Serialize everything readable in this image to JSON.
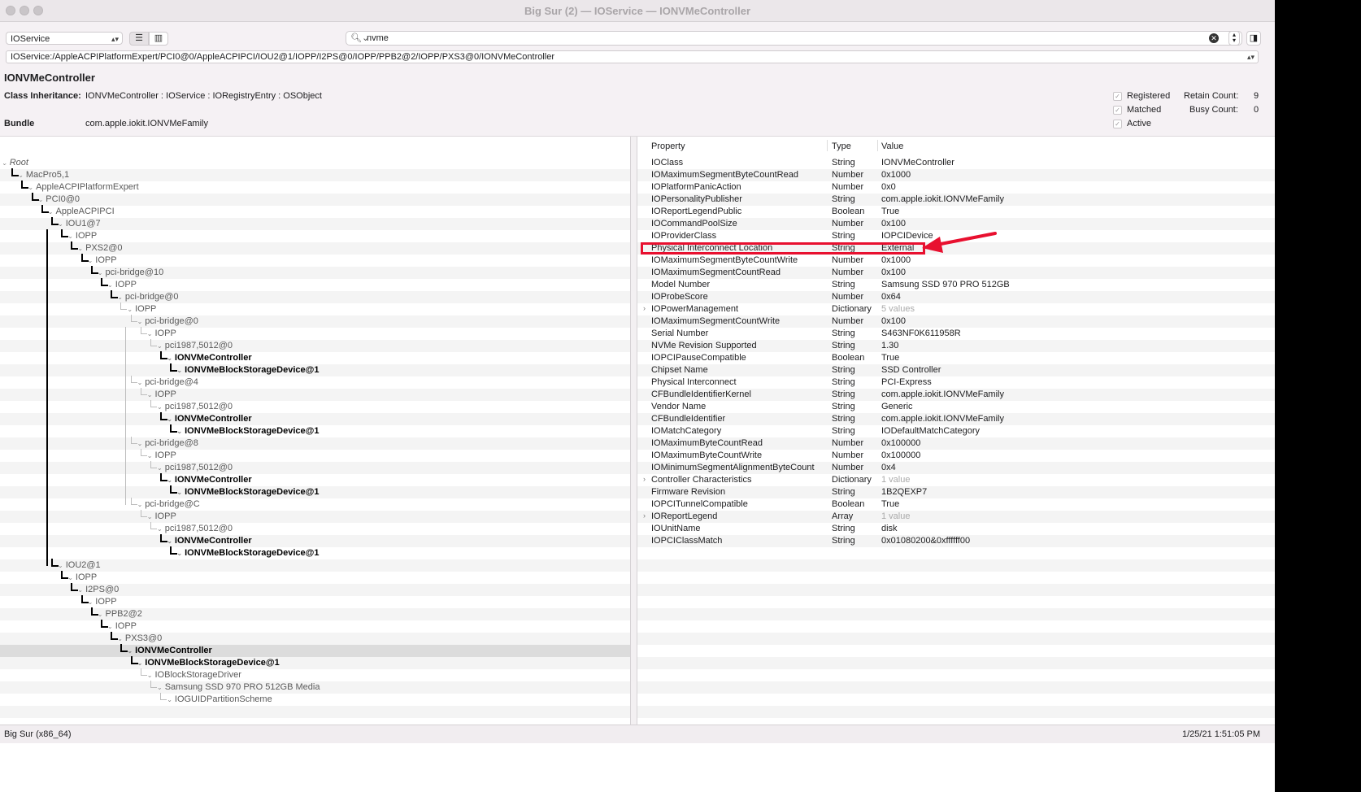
{
  "window": {
    "title": "Big Sur (2) — IOService — IONVMeController"
  },
  "toolbar": {
    "plane": "IOService",
    "search_value": "nvme",
    "path": "IOService:/AppleACPIPlatformExpert/PCI0@0/AppleACPIPCI/IOU2@1/IOPP/I2PS@0/IOPP/PPB2@2/IOPP/PXS3@0/IONVMeController"
  },
  "info": {
    "class_name": "IONVMeController",
    "inheritance_label": "Class Inheritance:",
    "inheritance_value": "IONVMeController : IOService : IORegistryEntry : OSObject",
    "bundle_label": "Bundle",
    "bundle_value": "com.apple.iokit.IONVMeFamily",
    "registered": "Registered",
    "matched": "Matched",
    "active": "Active",
    "retain_label": "Retain Count:",
    "retain_value": "9",
    "busy_label": "Busy Count:",
    "busy_value": "0"
  },
  "tree": [
    {
      "label": "Root",
      "depth": 0,
      "style": "root"
    },
    {
      "label": "MacPro5,1",
      "depth": 1,
      "style": "g"
    },
    {
      "label": "AppleACPIPlatformExpert",
      "depth": 2,
      "style": "g"
    },
    {
      "label": "PCI0@0",
      "depth": 3,
      "style": "g"
    },
    {
      "label": "AppleACPIPCI",
      "depth": 4,
      "style": "g"
    },
    {
      "label": "IOU1@7",
      "depth": 5,
      "style": "g"
    },
    {
      "label": "IOPP",
      "depth": 6,
      "style": "g"
    },
    {
      "label": "PXS2@0",
      "depth": 7,
      "style": "g"
    },
    {
      "label": "IOPP",
      "depth": 8,
      "style": "g"
    },
    {
      "label": "pci-bridge@10",
      "depth": 9,
      "style": "g"
    },
    {
      "label": "IOPP",
      "depth": 10,
      "style": "g"
    },
    {
      "label": "pci-bridge@0",
      "depth": 11,
      "style": "g"
    },
    {
      "label": "IOPP",
      "depth": 12,
      "style": "g"
    },
    {
      "label": "pci-bridge@0",
      "depth": 13,
      "style": "g"
    },
    {
      "label": "IOPP",
      "depth": 14,
      "style": "g"
    },
    {
      "label": "pci1987,5012@0",
      "depth": 15,
      "style": "g"
    },
    {
      "label": "IONVMeController",
      "depth": 16,
      "style": "b"
    },
    {
      "label": "IONVMeBlockStorageDevice@1",
      "depth": 17,
      "style": "b"
    },
    {
      "label": "pci-bridge@4",
      "depth": 13,
      "style": "g"
    },
    {
      "label": "IOPP",
      "depth": 14,
      "style": "g"
    },
    {
      "label": "pci1987,5012@0",
      "depth": 15,
      "style": "g"
    },
    {
      "label": "IONVMeController",
      "depth": 16,
      "style": "b"
    },
    {
      "label": "IONVMeBlockStorageDevice@1",
      "depth": 17,
      "style": "b"
    },
    {
      "label": "pci-bridge@8",
      "depth": 13,
      "style": "g"
    },
    {
      "label": "IOPP",
      "depth": 14,
      "style": "g"
    },
    {
      "label": "pci1987,5012@0",
      "depth": 15,
      "style": "g"
    },
    {
      "label": "IONVMeController",
      "depth": 16,
      "style": "b"
    },
    {
      "label": "IONVMeBlockStorageDevice@1",
      "depth": 17,
      "style": "b"
    },
    {
      "label": "pci-bridge@C",
      "depth": 13,
      "style": "g"
    },
    {
      "label": "IOPP",
      "depth": 14,
      "style": "g"
    },
    {
      "label": "pci1987,5012@0",
      "depth": 15,
      "style": "g"
    },
    {
      "label": "IONVMeController",
      "depth": 16,
      "style": "b"
    },
    {
      "label": "IONVMeBlockStorageDevice@1",
      "depth": 17,
      "style": "b"
    },
    {
      "label": "IOU2@1",
      "depth": 5,
      "style": "g"
    },
    {
      "label": "IOPP",
      "depth": 6,
      "style": "g"
    },
    {
      "label": "I2PS@0",
      "depth": 7,
      "style": "g"
    },
    {
      "label": "IOPP",
      "depth": 8,
      "style": "g"
    },
    {
      "label": "PPB2@2",
      "depth": 9,
      "style": "g"
    },
    {
      "label": "IOPP",
      "depth": 10,
      "style": "g"
    },
    {
      "label": "PXS3@0",
      "depth": 11,
      "style": "g"
    },
    {
      "label": "IONVMeController",
      "depth": 12,
      "style": "b",
      "selected": true
    },
    {
      "label": "IONVMeBlockStorageDevice@1",
      "depth": 13,
      "style": "b"
    },
    {
      "label": "IOBlockStorageDriver",
      "depth": 14,
      "style": "g"
    },
    {
      "label": "Samsung SSD 970 PRO 512GB Media",
      "depth": 15,
      "style": "g"
    },
    {
      "label": "IOGUIDPartitionScheme",
      "depth": 16,
      "style": "g"
    }
  ],
  "props_header": {
    "property": "Property",
    "type": "Type",
    "value": "Value"
  },
  "properties": [
    {
      "name": "IOClass",
      "type": "String",
      "value": "IONVMeController"
    },
    {
      "name": "IOMaximumSegmentByteCountRead",
      "type": "Number",
      "value": "0x1000"
    },
    {
      "name": "IOPlatformPanicAction",
      "type": "Number",
      "value": "0x0"
    },
    {
      "name": "IOPersonalityPublisher",
      "type": "String",
      "value": "com.apple.iokit.IONVMeFamily"
    },
    {
      "name": "IOReportLegendPublic",
      "type": "Boolean",
      "value": "True"
    },
    {
      "name": "IOCommandPoolSize",
      "type": "Number",
      "value": "0x100"
    },
    {
      "name": "IOProviderClass",
      "type": "String",
      "value": "IOPCIDevice"
    },
    {
      "name": "Physical Interconnect Location",
      "type": "String",
      "value": "External",
      "highlight": true
    },
    {
      "name": "IOMaximumSegmentByteCountWrite",
      "type": "Number",
      "value": "0x1000"
    },
    {
      "name": "IOMaximumSegmentCountRead",
      "type": "Number",
      "value": "0x100"
    },
    {
      "name": "Model Number",
      "type": "String",
      "value": "Samsung SSD 970 PRO 512GB"
    },
    {
      "name": "IOProbeScore",
      "type": "Number",
      "value": "0x64"
    },
    {
      "name": "IOPowerManagement",
      "type": "Dictionary",
      "value": "5 values",
      "expandable": true,
      "dim": true
    },
    {
      "name": "IOMaximumSegmentCountWrite",
      "type": "Number",
      "value": "0x100"
    },
    {
      "name": "Serial Number",
      "type": "String",
      "value": "S463NF0K611958R"
    },
    {
      "name": "NVMe Revision Supported",
      "type": "String",
      "value": "1.30"
    },
    {
      "name": "IOPCIPauseCompatible",
      "type": "Boolean",
      "value": "True"
    },
    {
      "name": "Chipset Name",
      "type": "String",
      "value": "SSD Controller"
    },
    {
      "name": "Physical Interconnect",
      "type": "String",
      "value": "PCI-Express"
    },
    {
      "name": "CFBundleIdentifierKernel",
      "type": "String",
      "value": "com.apple.iokit.IONVMeFamily"
    },
    {
      "name": "Vendor Name",
      "type": "String",
      "value": "Generic"
    },
    {
      "name": "CFBundleIdentifier",
      "type": "String",
      "value": "com.apple.iokit.IONVMeFamily"
    },
    {
      "name": "IOMatchCategory",
      "type": "String",
      "value": "IODefaultMatchCategory"
    },
    {
      "name": "IOMaximumByteCountRead",
      "type": "Number",
      "value": "0x100000"
    },
    {
      "name": "IOMaximumByteCountWrite",
      "type": "Number",
      "value": "0x100000"
    },
    {
      "name": "IOMinimumSegmentAlignmentByteCount",
      "type": "Number",
      "value": "0x4"
    },
    {
      "name": "Controller Characteristics",
      "type": "Dictionary",
      "value": "1 value",
      "expandable": true,
      "dim": true
    },
    {
      "name": "Firmware Revision",
      "type": "String",
      "value": "1B2QEXP7"
    },
    {
      "name": "IOPCITunnelCompatible",
      "type": "Boolean",
      "value": "True"
    },
    {
      "name": "IOReportLegend",
      "type": "Array",
      "value": "1 value",
      "expandable": true,
      "dim": true
    },
    {
      "name": "IOUnitName",
      "type": "String",
      "value": "disk"
    },
    {
      "name": "IOPCIClassMatch",
      "type": "String",
      "value": "0x01080200&0xffffff00"
    }
  ],
  "status": {
    "left": "Big Sur (x86_64)",
    "right": "1/25/21 1:51:05 PM"
  },
  "colors": {
    "annotation": "#e8102f",
    "selection": "#dcdcdc"
  }
}
